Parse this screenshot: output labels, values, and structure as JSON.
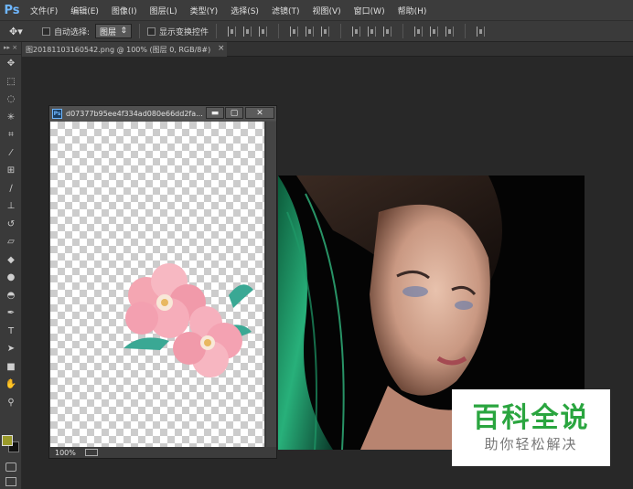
{
  "app": {
    "logo": "Ps"
  },
  "menu": [
    "文件(F)",
    "编辑(E)",
    "图像(I)",
    "图层(L)",
    "类型(Y)",
    "选择(S)",
    "滤镜(T)",
    "视图(V)",
    "窗口(W)",
    "帮助(H)"
  ],
  "options": {
    "auto_select_label": "自动选择:",
    "auto_select_value": "图层",
    "show_transform_label": "显示变换控件"
  },
  "tabs": [
    {
      "label": "图20181103160542.png @ 100% (图层 0, RGB/8#)",
      "close": "×"
    }
  ],
  "float_window": {
    "icon": "Ps",
    "title": "d07377b95ee4f334ad080e66dd2fa...",
    "minimize": "▬",
    "restore": "▢",
    "close": "✕",
    "zoom": "100%"
  },
  "toolbox": {
    "header": "▸▸ ×",
    "fg_color": "#9a9a2a",
    "bg_color": "#111111",
    "tools": [
      "move-tool",
      "marquee-tool",
      "lasso-tool",
      "magic-wand-tool",
      "crop-tool",
      "eyedropper-tool",
      "healing-brush-tool",
      "brush-tool",
      "clone-stamp-tool",
      "history-brush-tool",
      "eraser-tool",
      "paint-bucket-tool",
      "blur-tool",
      "dodge-tool",
      "pen-tool",
      "type-tool",
      "path-selection-tool",
      "rectangle-tool",
      "hand-tool",
      "zoom-tool"
    ]
  },
  "watermark": {
    "main": "百科全说",
    "sub": "助你轻松解决"
  }
}
